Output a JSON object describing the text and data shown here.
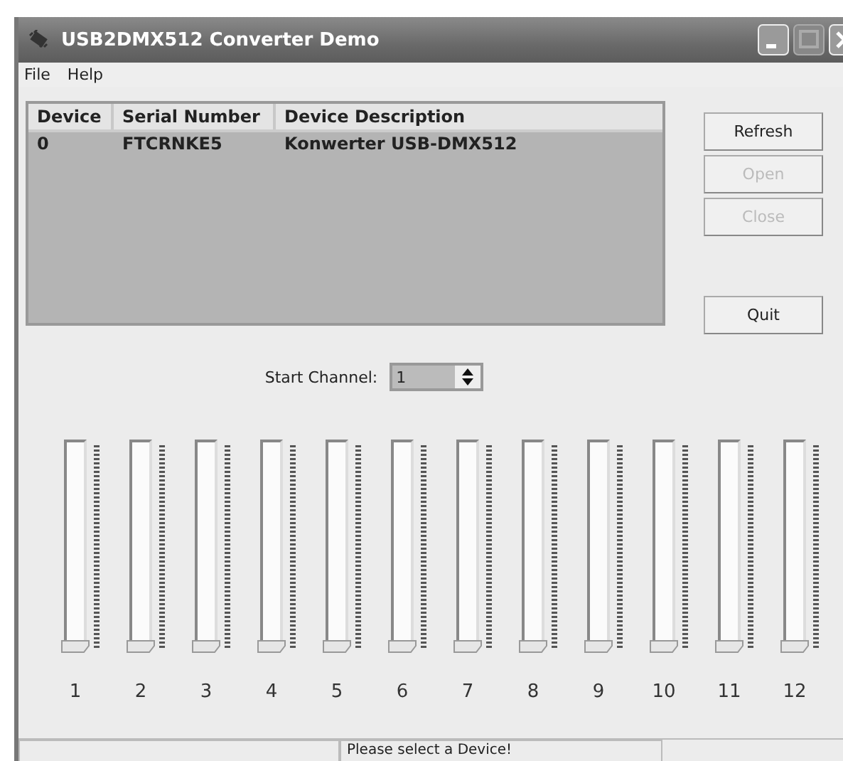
{
  "window": {
    "title": "USB2DMX512 Converter Demo"
  },
  "menu": [
    {
      "label": "File"
    },
    {
      "label": "Help"
    }
  ],
  "device_list": {
    "columns": [
      "Device",
      "Serial Number",
      "Device Description"
    ],
    "rows": [
      [
        "0",
        "FTCRNKE5",
        "Konwerter USB-DMX512"
      ]
    ]
  },
  "buttons": [
    {
      "label": "Refresh",
      "disabled": false
    },
    {
      "label": "Open",
      "disabled": true
    },
    {
      "label": "Close",
      "disabled": true
    },
    {
      "label": "Quit",
      "disabled": false
    }
  ],
  "start_channel": {
    "label": "Start Channel:",
    "value": "1"
  },
  "channels": [
    {
      "label": "1",
      "level": 0
    },
    {
      "label": "2",
      "level": 0
    },
    {
      "label": "3",
      "level": 0
    },
    {
      "label": "4",
      "level": 0
    },
    {
      "label": "5",
      "level": 0
    },
    {
      "label": "6",
      "level": 0
    },
    {
      "label": "7",
      "level": 0
    },
    {
      "label": "8",
      "level": 0
    },
    {
      "label": "9",
      "level": 0
    },
    {
      "label": "10",
      "level": 0
    },
    {
      "label": "11",
      "level": 0
    },
    {
      "label": "12",
      "level": 0
    }
  ],
  "status_bar": {
    "text": "Please select a Device!"
  }
}
